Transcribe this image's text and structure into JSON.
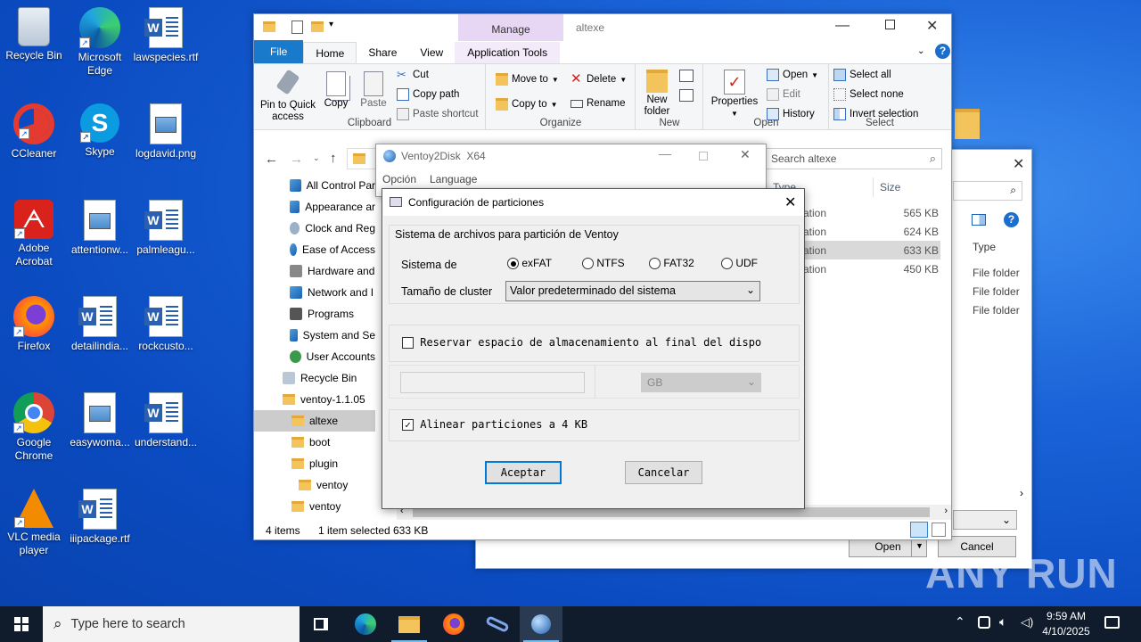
{
  "desktop": {
    "icons": [
      {
        "label": "Recycle Bin"
      },
      {
        "label": "Microsoft Edge"
      },
      {
        "label": "lawspecies.rtf"
      },
      {
        "label": "CCleaner"
      },
      {
        "label": "Skype"
      },
      {
        "label": "logdavid.png"
      },
      {
        "label": "Adobe Acrobat"
      },
      {
        "label": "attentionw..."
      },
      {
        "label": "palmleagu..."
      },
      {
        "label": "Firefox"
      },
      {
        "label": "detailindia..."
      },
      {
        "label": "rockcusto..."
      },
      {
        "label": "Google Chrome"
      },
      {
        "label": "easywoma..."
      },
      {
        "label": "understand..."
      },
      {
        "label": "VLC media player"
      },
      {
        "label": "iiipackage.rtf"
      }
    ]
  },
  "explorer": {
    "title": "altexe",
    "manage_label": "Manage",
    "tabs": [
      "File",
      "Home",
      "Share",
      "View",
      "Application Tools"
    ],
    "clipboard": {
      "pin": "Pin to Quick access",
      "copy": "Copy",
      "paste": "Paste",
      "cut": "Cut",
      "copy_path": "Copy path",
      "paste_shortcut": "Paste shortcut",
      "group": "Clipboard"
    },
    "organize": {
      "move_to": "Move to",
      "copy_to": "Copy to",
      "delete": "Delete",
      "rename": "Rename",
      "group": "Organize"
    },
    "new": {
      "new_folder": "New folder",
      "group": "New"
    },
    "open": {
      "properties": "Properties",
      "open": "Open",
      "edit": "Edit",
      "history": "History",
      "group": "Open"
    },
    "select": {
      "select_all": "Select all",
      "select_none": "Select none",
      "invert": "Invert selection",
      "group": "Select"
    },
    "search_placeholder": "Search altexe",
    "columns": {
      "type": "Type",
      "size": "Size"
    },
    "rows": [
      {
        "type": "ation",
        "size": "565 KB"
      },
      {
        "type": "ation",
        "size": "624 KB"
      },
      {
        "type": "ation",
        "size": "633 KB"
      },
      {
        "type": "ation",
        "size": "450 KB"
      }
    ],
    "nav": [
      "All Control Par",
      "Appearance ar",
      "Clock and Reg",
      "Ease of Access",
      "Hardware and",
      "Network and I",
      "Programs",
      "System and Se",
      "User Accounts",
      "Recycle Bin",
      "ventoy-1.1.05",
      "altexe",
      "boot",
      "plugin",
      "ventoy",
      "ventoy"
    ],
    "status": {
      "items": "4 items",
      "selected": "1 item selected",
      "size": "633 KB"
    }
  },
  "bg_dialog": {
    "type_header": "Type",
    "types": [
      "File folder",
      "File folder",
      "File folder"
    ],
    "open": "Open",
    "cancel": "Cancel"
  },
  "ventoy": {
    "title": "Ventoy2Disk  X64",
    "menu": [
      "Opción",
      "Language"
    ]
  },
  "partition_dialog": {
    "title": "Configuración de particiones",
    "fs_group": "Sistema de archivos para partición de Ventoy",
    "fs_label": "Sistema de",
    "fs_options": [
      "exFAT",
      "NTFS",
      "FAT32",
      "UDF"
    ],
    "fs_selected": "exFAT",
    "cluster_label": "Tamaño de cluster",
    "cluster_value": "Valor predeterminado del sistema",
    "reserve_label": "Reservar espacio de almacenamiento al final del dispo",
    "reserve_checked": false,
    "unit": "GB",
    "align_label": "Alinear particiones a 4 KB",
    "align_checked": true,
    "accept": "Aceptar",
    "cancel": "Cancelar"
  },
  "taskbar": {
    "search_placeholder": "Type here to search",
    "time": "9:59 AM",
    "date": "4/10/2025"
  },
  "watermark": "ANY RUN"
}
